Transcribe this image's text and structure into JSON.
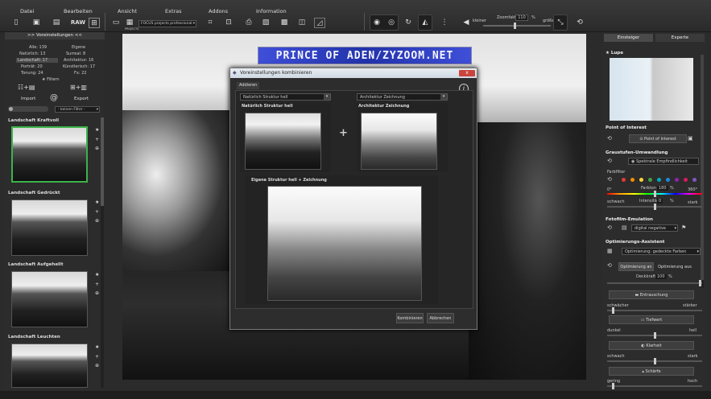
{
  "menu": [
    "Datei",
    "Bearbeiten",
    "Ansicht",
    "Extras",
    "Addons",
    "Information"
  ],
  "toolbar": {
    "raw_label": "RAW",
    "projects_label": "PROJECTS",
    "projects_select": "FOCUS projects professional",
    "kleiner_label": "kleiner",
    "zoom_label": "Zoomfaktor",
    "zoom_value": "110",
    "zoom_unit": "%",
    "groesser_label": "größer"
  },
  "left_panel": {
    "title": ">> Voreinstellungen <<",
    "stats": [
      {
        "label": "Alle: 139",
        "highlight": false
      },
      {
        "label": "Eigene",
        "highlight": false
      },
      {
        "label": "Natürlich: 13",
        "highlight": false
      },
      {
        "label": "Surreal: 8",
        "highlight": false
      },
      {
        "label": "Landschaft: 17",
        "highlight": true
      },
      {
        "label": "Architektur: 16",
        "highlight": false
      },
      {
        "label": "Porträt: 20",
        "highlight": false
      },
      {
        "label": "Künstlerisch: 17",
        "highlight": false
      },
      {
        "label": "Tonung: 24",
        "highlight": false
      },
      {
        "label": "Fx: 22",
        "highlight": false
      }
    ],
    "filter_label": "Filtern",
    "import_label": "Import",
    "export_label": "Export",
    "filter_select": "- keinen Filter -",
    "presets": [
      "Landschaft Kraftvoll",
      "Landschaft Gedrückt",
      "Landschaft Aufgehellt",
      "Landschaft Leuchten"
    ]
  },
  "watermark": "PRINCE OF ADEN/ZYZOOM.NET",
  "dialog": {
    "title": "Voreinstellungen kombinieren",
    "close": "x",
    "tab": "Addieren",
    "info": "i",
    "select_left": "Natürlich Struktur hell",
    "select_right": "Architektur Zeichnung",
    "caption_left": "Natürlich Struktur hell",
    "caption_right": "Architektur Zeichnung",
    "caption_result": "Eigene Struktur hell + Zeichnung",
    "plus": "+",
    "combine_button": "Kombinieren",
    "cancel_button": "Abbrechen"
  },
  "right_panel": {
    "tab_beginner": "Einsteiger",
    "tab_expert": "Experte",
    "lupe": "Lupe",
    "poi_title": "Point of Interest",
    "poi_button": "Point of Interest",
    "gray_title": "Graustufen-Umwandlung",
    "gray_select": "Spektrale Empfindlichkeit",
    "farbfilter": "Farbfilter",
    "farbton": "Farbton",
    "farbton_value": "180",
    "degree_left": "0°",
    "degree_right": "360°",
    "schwach": "schwach",
    "intensitaet": "Intensität",
    "intensitaet_value": "0",
    "percent": "%",
    "stark": "stark",
    "film_title": "Fotofilm-Emulation",
    "film_select": "digital negative",
    "assist_title": "Optimierungs-Assistent",
    "assist_select": "Optimierung: gedeckte Farben",
    "opt_on": "Optimierung an",
    "opt_off": "Optimierung aus",
    "deckkraft": "Deckkraft",
    "deckkraft_value": "100",
    "entrauschung": "Entrauschung",
    "schwaecher": "schwächer",
    "staerker": "stärker",
    "tiefwert": "Tiefwert",
    "dunkel": "dunkel",
    "hell": "hell",
    "klarheit": "Klarheit",
    "schaerfe": "Schärfe",
    "gering": "gering",
    "hoch": "hoch"
  },
  "colors": {
    "selection": "#3cb34a",
    "swatches": [
      "#e53935",
      "#fb8c00",
      "#fdd835",
      "#43a047",
      "#00acc1",
      "#1e88e5",
      "#8e24aa",
      "#d81b60",
      "#7e57c2"
    ]
  }
}
